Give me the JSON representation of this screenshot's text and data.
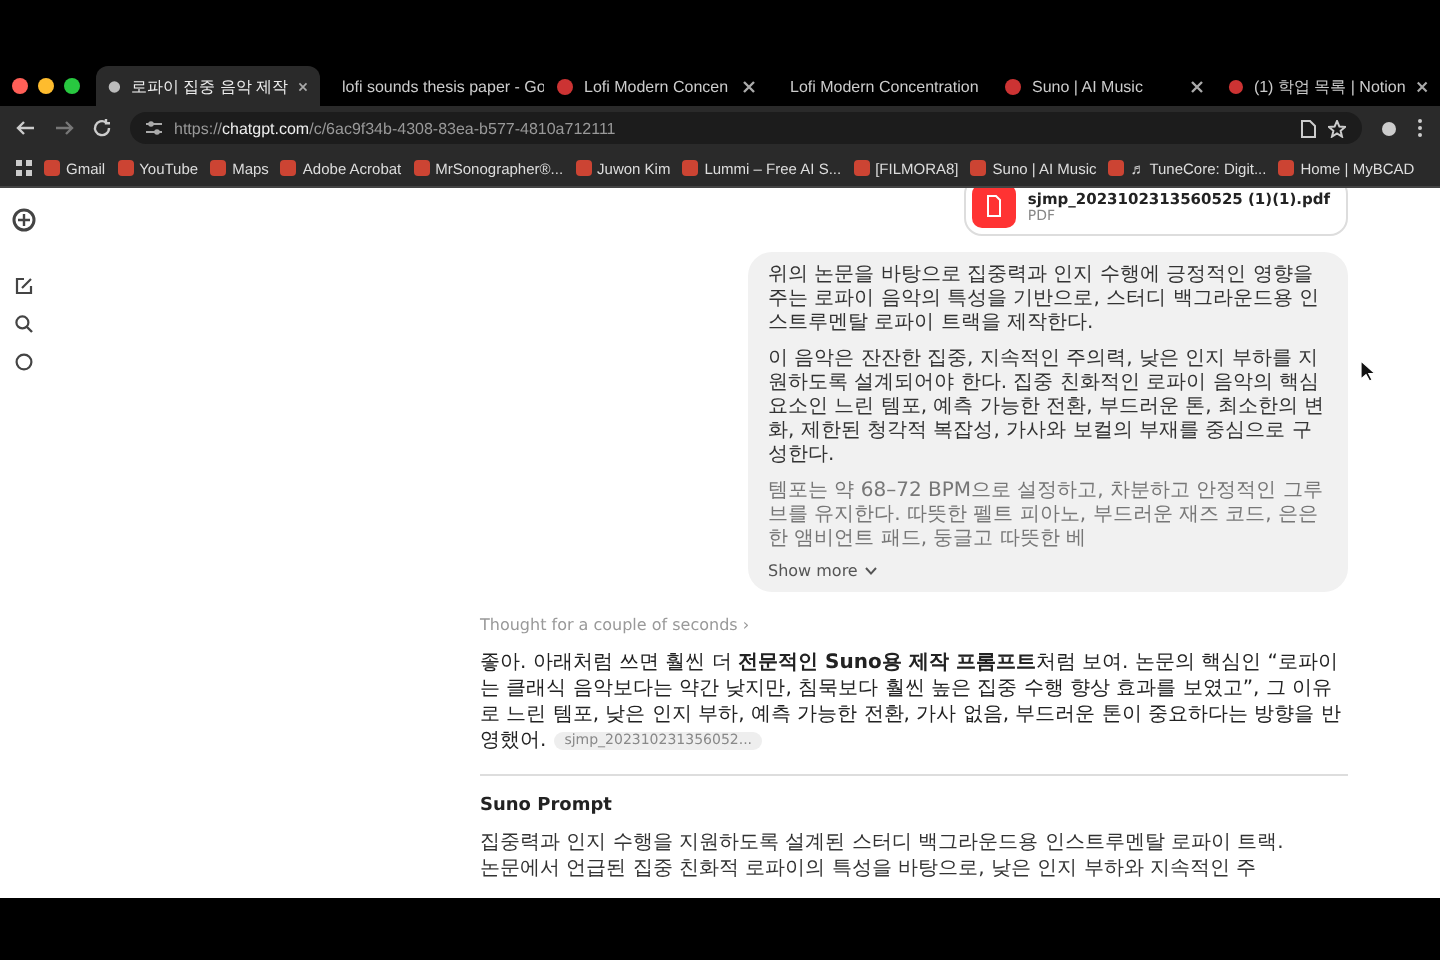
{
  "tabs": [
    {
      "label": "로파이 집중 음악 제작",
      "selected": true
    },
    {
      "label": "lofi sounds thesis paper - Go",
      "selected": false
    },
    {
      "label": "Lofi Modern Concen",
      "selected": false
    },
    {
      "label": "Lofi Modern Concentration",
      "selected": false
    },
    {
      "label": "Suno | AI Music",
      "selected": false
    },
    {
      "label": "(1) 학업 목록 | Notion",
      "selected": false
    }
  ],
  "address_bar": {
    "url_prefix": "https://",
    "domain": "chatgpt.com",
    "url_path": "/c/6ac9f34b-4308-83ea-b577-4810a712111"
  },
  "bookmarks": [
    "Gmail",
    "YouTube",
    "Maps",
    "Adobe Acrobat",
    "MrSonographer®...",
    "Juwon Kim",
    "Lummi – Free AI S...",
    "[FILMORA8]",
    "Suno | AI Music",
    "♬ TuneCore: Digit...",
    "Home | MyBCAD"
  ],
  "attachment": {
    "filename": "sjmp_20231023135605​25 (1)(1).pdf",
    "type": "PDF"
  },
  "user_message": {
    "paragraphs": [
      "위의 논문을 바탕으로 집중력과 인지 수행에 긍정적인 영향을 주는 로파이 음악의 특성을 기반으로, 스터디 백그라운드용 인스트루멘탈 로파이 트랙을 제작한다.",
      "이 음악은 잔잔한 집중, 지속적인 주의력, 낮은 인지 부하를 지원하도록 설계되어야 한다. 집중 친화적인 로파이 음악의 핵심 요소인 느린 템포, 예측 가능한 전환, 부드러운 톤, 최소한의 변화, 제한된 청각적 복잡성, 가사와 보컬의 부재를 중심으로 구성한다.",
      "템포는 약 68–72 BPM으로 설정하고, 차분하고 안정적인 그루브를 유지한다. 따뜻한 펠트 피아노, 부드러운 재즈 코드, 은은한 앰비언트 패드, 둥글고 따뜻한 베"
    ],
    "show_more": "Show more"
  },
  "thought": "Thought for a couple of seconds ›",
  "assistant_message": {
    "text": "좋아. 아래처럼 쓰면 훨씬 더 **전문적인 Suno용 제작 프롬프트**처럼 보여. 논문의 핵심인 “로파이는 클래식 음악보다는 약간 낮지만, 침묵보다 훨씬 높은 집중 수행 향상 효과를 보였고”, 그 이유로 느린 템포, 낮은 인지 부하, 예측 가능한 전환, 가사 없음, 부드러운 톤이 중요하다는 방향을 반영했어.",
    "citation": "sjmp_202310231356052..."
  },
  "section": {
    "heading": "Suno Prompt",
    "lines": [
      "집중력과 인지 수행을 지원하도록 설계된 스터디 백그라운드용 인스트루멘탈 로파이 트랙.",
      "논문에서 언급된 집중 친화적 로파이의 특성을 바탕으로, 낮은 인지 부하와 지속적인 주"
    ]
  }
}
